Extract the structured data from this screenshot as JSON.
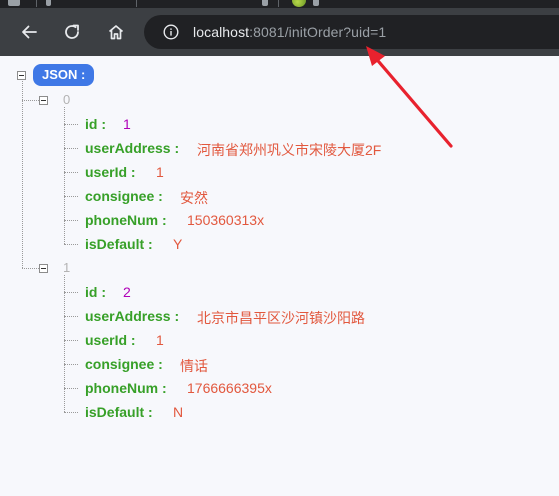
{
  "browser": {
    "url_host": "localhost",
    "url_rest": ":8081/initOrder?uid=1"
  },
  "json_viewer": {
    "root_label": "JSON :",
    "items": [
      {
        "index": "0",
        "fields": [
          {
            "key": "id :",
            "value": "1",
            "type": "number"
          },
          {
            "key": "userAddress :",
            "value": "河南省郑州巩义市宋陵大厦2F",
            "type": "string"
          },
          {
            "key": "userId :",
            "value": "1",
            "type": "string"
          },
          {
            "key": "consignee :",
            "value": "安然",
            "type": "string"
          },
          {
            "key": "phoneNum :",
            "value": "150360313x",
            "type": "string"
          },
          {
            "key": "isDefault :",
            "value": "Y",
            "type": "string"
          }
        ]
      },
      {
        "index": "1",
        "fields": [
          {
            "key": "id :",
            "value": "2",
            "type": "number"
          },
          {
            "key": "userAddress :",
            "value": "北京市昌平区沙河镇沙阳路",
            "type": "string"
          },
          {
            "key": "userId :",
            "value": "1",
            "type": "string"
          },
          {
            "key": "consignee :",
            "value": "情话",
            "type": "string"
          },
          {
            "key": "phoneNum :",
            "value": "1766666395x",
            "type": "string"
          },
          {
            "key": "isDefault :",
            "value": "N",
            "type": "string"
          }
        ]
      }
    ]
  },
  "colors": {
    "key": "#37a028",
    "string_value": "#e2583e",
    "number_value": "#b000b8",
    "badge": "#3f78e6",
    "annotation_arrow": "#e8222e"
  }
}
